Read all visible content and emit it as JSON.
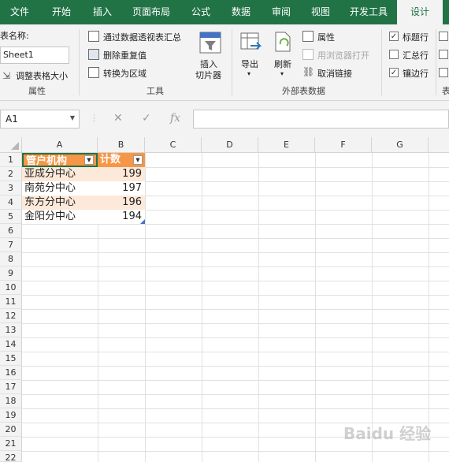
{
  "tabs": [
    "文件",
    "开始",
    "插入",
    "页面布局",
    "公式",
    "数据",
    "审阅",
    "视图",
    "开发工具",
    "设计"
  ],
  "ribbon": {
    "properties": {
      "table_name_label": "表名称:",
      "table_name_value": "Sheet1",
      "resize_label": "调整表格大小",
      "group_label": "属性"
    },
    "tools": {
      "pivot_label": "通过数据透视表汇总",
      "remove_dup_label": "删除重复值",
      "convert_label": "转换为区域",
      "slicer_label_1": "插入",
      "slicer_label_2": "切片器",
      "group_label": "工具"
    },
    "external": {
      "export_label": "导出",
      "refresh_label": "刷新",
      "properties_label": "属性",
      "browser_label": "用浏览器打开",
      "unlink_label": "取消链接",
      "group_label": "外部表数据"
    },
    "style_options": {
      "header_row_label": "标题行",
      "header_row_checked": true,
      "total_row_label": "汇总行",
      "total_row_checked": false,
      "banded_rows_label": "镶边行",
      "banded_rows_checked": true,
      "group_label_partial": "表"
    }
  },
  "formula_bar": {
    "name_box": "A1",
    "fx": "fx",
    "cancel": "✕",
    "enter": "✓"
  },
  "sheet": {
    "columns": [
      "A",
      "B",
      "C",
      "D",
      "E",
      "F",
      "G"
    ],
    "row_numbers": [
      "1",
      "2",
      "3",
      "4",
      "5",
      "6",
      "7",
      "8",
      "9",
      "10",
      "11",
      "12",
      "13",
      "14",
      "15",
      "16",
      "17",
      "18",
      "19",
      "20",
      "21",
      "22"
    ],
    "headers": [
      "管户机构",
      "计数"
    ],
    "rows": [
      [
        "亚成分中心",
        "199"
      ],
      [
        "南苑分中心",
        "197"
      ],
      [
        "东方分中心",
        "196"
      ],
      [
        "金阳分中心",
        "194"
      ]
    ]
  },
  "watermark": "Baidu 经验"
}
